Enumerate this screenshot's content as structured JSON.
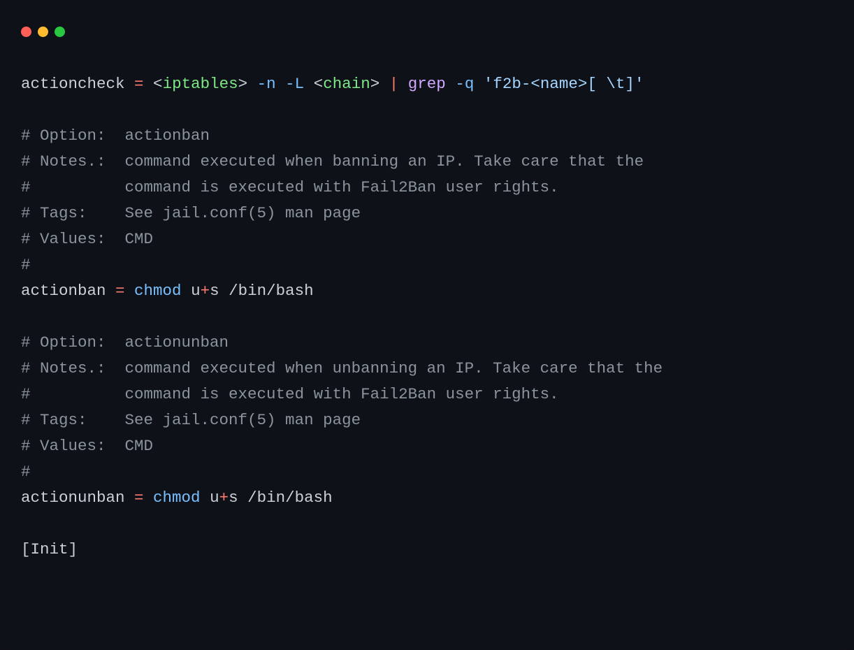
{
  "window": {
    "buttons": {
      "close": "red",
      "min": "yellow",
      "max": "green"
    }
  },
  "code": {
    "line1": {
      "key": "actioncheck",
      "eq": " = ",
      "lt1": "<",
      "tag1": "iptables",
      "gt1": ">",
      "sp1": " ",
      "flag1": "-n",
      "sp2": " ",
      "flag2": "-L",
      "sp3": " ",
      "lt2": "<",
      "tag2": "chain",
      "gt2": ">",
      "sp4": " ",
      "pipe": "|",
      "sp5": " ",
      "grep": "grep",
      "sp6": " ",
      "flag3": "-q",
      "sp7": " ",
      "str_q1": "'",
      "str_a": "f2b-",
      "str_lt": "<",
      "str_tag": "name",
      "str_gt": ">",
      "str_b": "[ \\t]",
      "str_q2": "'"
    },
    "blank1": "",
    "c1": "# Option:  actionban",
    "c2": "# Notes.:  command executed when banning an IP. Take care that the",
    "c3": "#          command is executed with Fail2Ban user rights.",
    "c4": "# Tags:    See jail.conf(5) man page",
    "c5": "# Values:  CMD",
    "c6": "#",
    "line_ab": {
      "key": "actionban",
      "eq": " = ",
      "cmd": "chmod",
      "sp1": " ",
      "arg_a": "u",
      "plus": "+",
      "arg_b": "s",
      "sp2": " ",
      "path": "/bin/bash"
    },
    "blank2": "",
    "c7": "# Option:  actionunban",
    "c8": "# Notes.:  command executed when unbanning an IP. Take care that the",
    "c9": "#          command is executed with Fail2Ban user rights.",
    "c10": "# Tags:    See jail.conf(5) man page",
    "c11": "# Values:  CMD",
    "c12": "#",
    "line_au": {
      "key": "actionunban",
      "eq": " = ",
      "cmd": "chmod",
      "sp1": " ",
      "arg_a": "u",
      "plus": "+",
      "arg_b": "s",
      "sp2": " ",
      "path": "/bin/bash"
    },
    "blank3": "",
    "section": "[Init]"
  }
}
